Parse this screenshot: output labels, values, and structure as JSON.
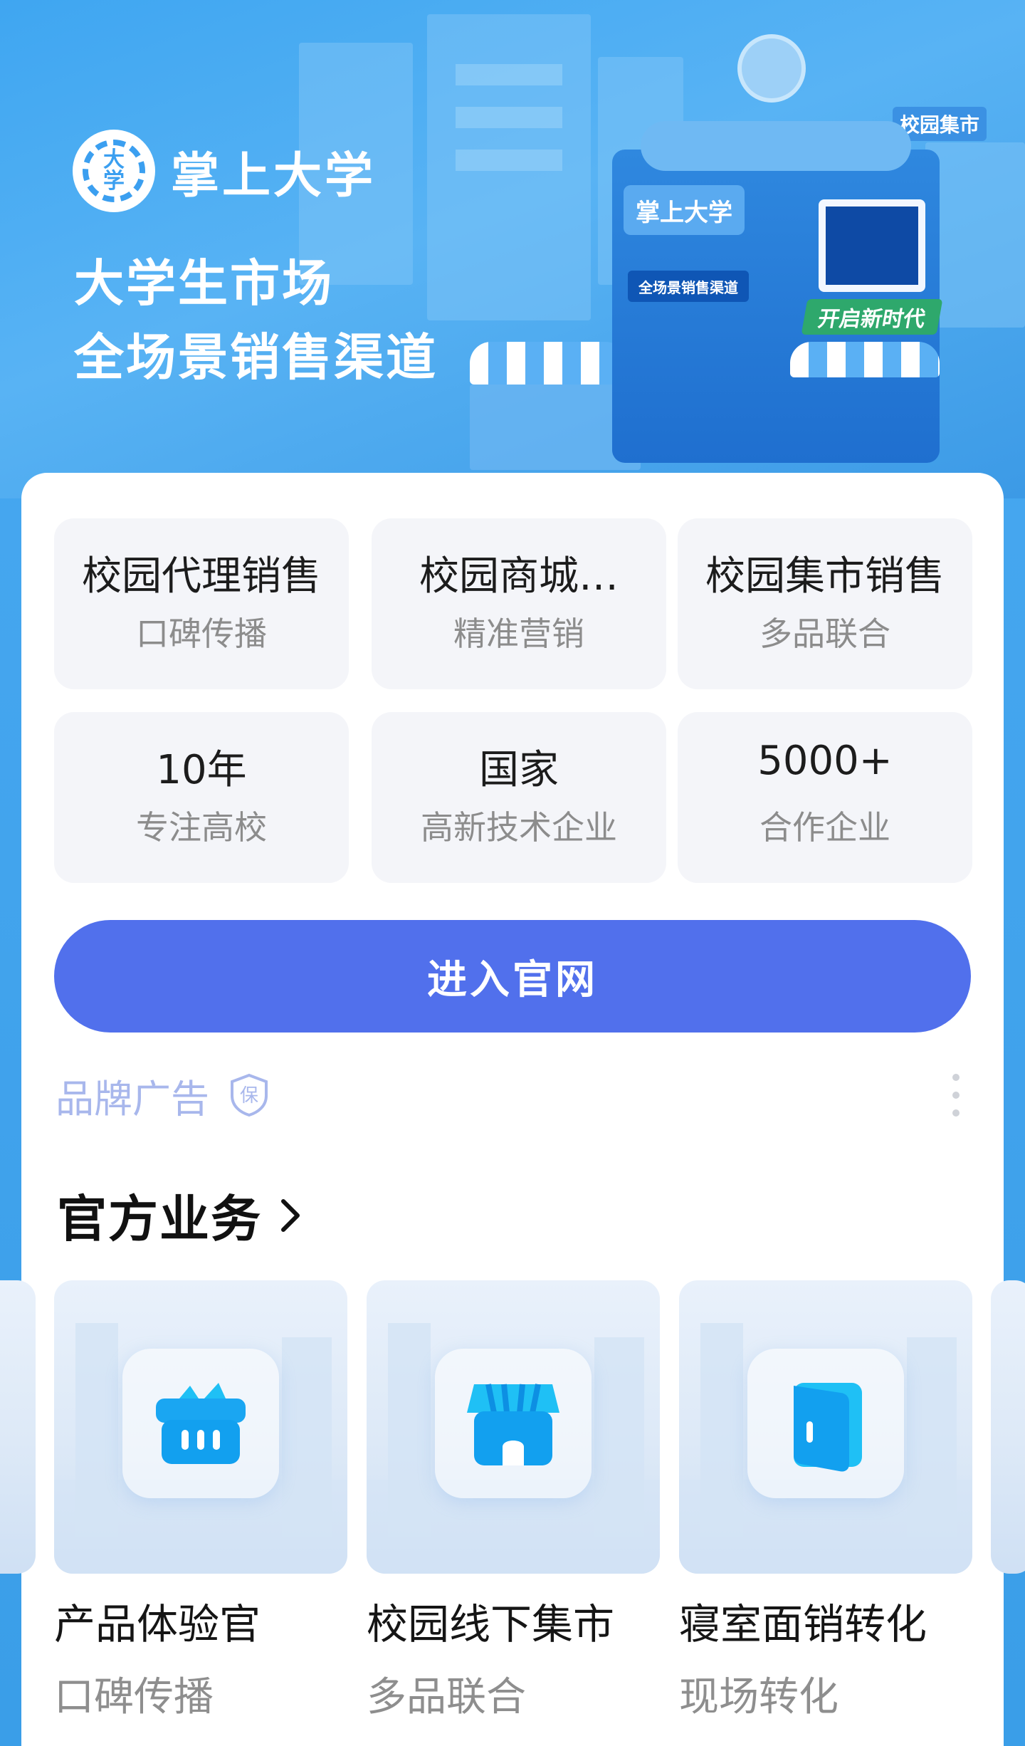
{
  "hero": {
    "logo_text": "大学",
    "brand_name": "掌上大学",
    "slogan_line1": "大学生市场",
    "slogan_line2": "全场景销售渠道",
    "illustration": {
      "kiosk_sign": "掌上大学",
      "kiosk_subsign": "全场景销售渠道",
      "green_banner": "开启新时代",
      "top_tag": "校园集市"
    }
  },
  "tiles": [
    {
      "main": "校园代理销售",
      "sub": "口碑传播"
    },
    {
      "main": "校园商城…",
      "sub": "精准营销"
    },
    {
      "main": "校园集市销售",
      "sub": "多品联合"
    },
    {
      "main": "10年",
      "sub": "专注高校"
    },
    {
      "main": "国家",
      "sub": "高新技术企业"
    },
    {
      "main": "5000+",
      "sub": "合作企业"
    }
  ],
  "cta_label": "进入官网",
  "ad": {
    "label": "品牌广告",
    "badge": "保"
  },
  "section": {
    "title": "官方业务"
  },
  "services": [
    {
      "title": "产品体验官",
      "sub": "口碑传播",
      "icon": "basket-icon"
    },
    {
      "title": "校园线下集市",
      "sub": "多品联合",
      "icon": "store-icon"
    },
    {
      "title": "寝室面销转化",
      "sub": "现场转化",
      "icon": "door-icon"
    }
  ],
  "colors": {
    "hero_bg": "#3fa6f1",
    "cta_bg": "#5170ec",
    "tile_bg": "#f4f5f9",
    "ad_label": "#a8b7ec",
    "icon_blue": "#1fa8f5"
  }
}
